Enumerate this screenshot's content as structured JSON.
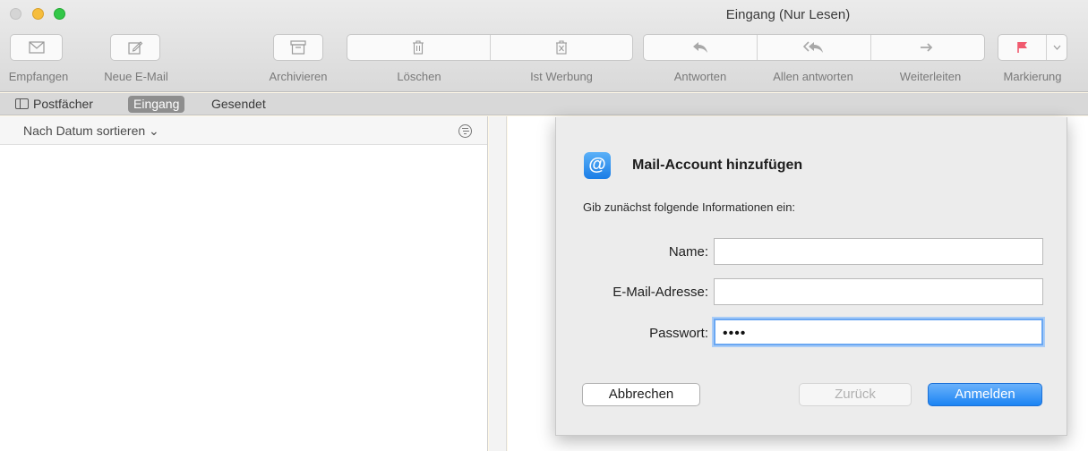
{
  "window": {
    "title": "Eingang (Nur Lesen)"
  },
  "toolbar": {
    "buttons": [
      {
        "label": "Empfangen",
        "icon": "envelope-icon"
      },
      {
        "label": "Neue E-Mail",
        "icon": "compose-icon"
      },
      {
        "label": "Archivieren",
        "icon": "archive-icon"
      },
      {
        "label": "Löschen",
        "icon": "trash-icon"
      },
      {
        "label": "Ist Werbung",
        "icon": "junk-icon"
      },
      {
        "label": "Antworten",
        "icon": "reply-icon"
      },
      {
        "label": "Allen antworten",
        "icon": "reply-all-icon"
      },
      {
        "label": "Weiterleiten",
        "icon": "forward-icon"
      },
      {
        "label": "Markierung",
        "icon": "flag-icon"
      }
    ]
  },
  "favorites": {
    "mailboxes": "Postfächer",
    "inbox": "Eingang",
    "sent": "Gesendet"
  },
  "list": {
    "sort_label": "Nach Datum sortieren ⌄"
  },
  "dialog": {
    "title": "Mail-Account hinzufügen",
    "subtitle": "Gib zunächst folgende Informationen ein:",
    "name_label": "Name:",
    "name_value": "",
    "email_label": "E-Mail-Adresse:",
    "email_value": "",
    "password_label": "Passwort:",
    "password_value": "••••",
    "cancel_label": "Abbrechen",
    "back_label": "Zurück",
    "login_label": "Anmelden"
  },
  "colors": {
    "accent": "#1b84f3",
    "flag": "#f05a6e"
  }
}
